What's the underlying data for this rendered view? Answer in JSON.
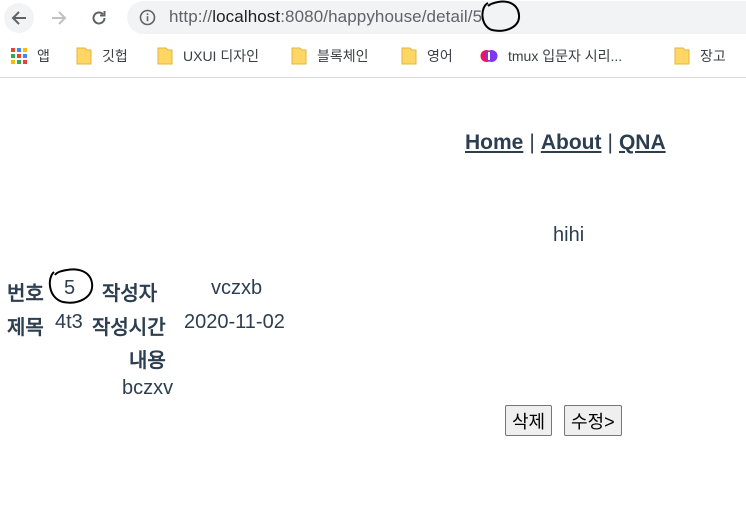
{
  "browser": {
    "url_scheme": "http://",
    "url_host": "localhost",
    "url_rest": ":8080/happyhouse/detail/5",
    "bookmarks": [
      {
        "label": "앱",
        "icon": "apps-grid-icon"
      },
      {
        "label": "깃헙",
        "icon": "folder-icon"
      },
      {
        "label": "UXUI 디자인",
        "icon": "folder-icon"
      },
      {
        "label": "블록체인",
        "icon": "folder-icon"
      },
      {
        "label": "영어",
        "icon": "folder-icon"
      },
      {
        "label": "tmux 입문자 시리...",
        "icon": "site-favicon"
      },
      {
        "label": "장고",
        "icon": "folder-icon"
      }
    ]
  },
  "nav": {
    "home": "Home",
    "sep1": "|",
    "about": "About",
    "sep2": "|",
    "qna": "QNA"
  },
  "greeting": "hihi",
  "detail": {
    "number_label": "번호",
    "number_value": "5",
    "writer_label": "작성자",
    "writer_value": "vczxb",
    "title_label": "제목",
    "title_value": "4t3",
    "time_label": "작성시간",
    "time_value": "2020-11-02",
    "content_label": "내용",
    "content_value": "bczxv"
  },
  "buttons": {
    "delete": "삭제",
    "edit": "수정>"
  }
}
